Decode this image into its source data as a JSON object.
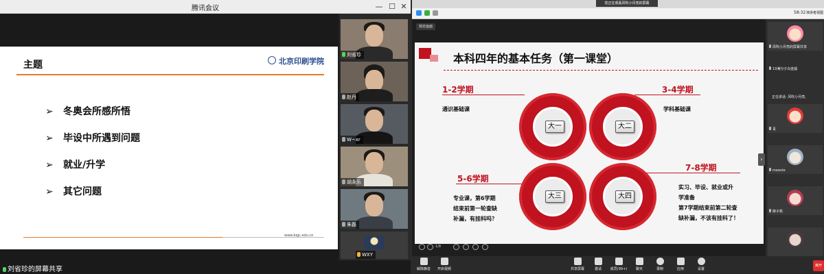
{
  "left_window": {
    "title": "腾讯会议",
    "controls": {
      "minimize": "—",
      "maximize": "☐",
      "close": "✕"
    },
    "slide": {
      "title": "主题",
      "logo_text": "北京印刷学院",
      "bullet_symbol": "➢",
      "bullets": [
        "冬奥会所感所悟",
        "毕设中所遇到问题",
        "就业/升学",
        "其它问题"
      ],
      "url": "www.bigc.edu.cn"
    },
    "participants": [
      {
        "name": "刘省珍"
      },
      {
        "name": "赵丹"
      },
      {
        "name": "W~xr"
      },
      {
        "name": "胡永乐"
      },
      {
        "name": "朱磊"
      },
      {
        "name": "WXY"
      }
    ],
    "share_status": "刘省珍的屏幕共享"
  },
  "right_window": {
    "banner": "您正在观看风吹小月亮的屏幕",
    "clock": "58:32",
    "fullscreen_label": "演讲者视图",
    "lock_label": "锁定画面",
    "slide": {
      "title": "本科四年的基本任务（第一课堂）",
      "quadrants": [
        {
          "gear_label": "大一",
          "semester": "1-2学期",
          "category": "通识基础课",
          "desc": []
        },
        {
          "gear_label": "大二",
          "semester": "3-4学期",
          "category": "学科基础课",
          "desc": []
        },
        {
          "gear_label": "大三",
          "semester": "5-6学期",
          "category": "",
          "desc": [
            "专业课，第6学期",
            "结束前第一轮查缺",
            "补漏，有挂科吗？"
          ]
        },
        {
          "gear_label": "大四",
          "semester": "7-8学期",
          "category": "",
          "desc": [
            "实习、毕设、就业或升",
            "学准备",
            "第7学期结束前第二轮查",
            "缺补漏，不该有挂科了！"
          ]
        }
      ]
    },
    "slide_pages": "1/8",
    "participants": [
      {
        "name": "风吹小月亮的屏幕共享"
      },
      {
        "name": "19满分子白金般"
      },
      {
        "name": "青"
      },
      {
        "name": "meeste"
      },
      {
        "name": "柳子帆"
      }
    ],
    "speaking_label": "正在讲话: 风吹小月亮,",
    "toolbar": [
      {
        "label": "解除静音"
      },
      {
        "label": "开启视频"
      },
      {
        "label": "共享屏幕"
      },
      {
        "label": "邀请"
      },
      {
        "label": "成员(99+)"
      },
      {
        "label": "聊天"
      },
      {
        "label": "录制"
      },
      {
        "label": "应用"
      },
      {
        "label": "设置"
      }
    ],
    "leave_label": "离开"
  },
  "colors": {
    "accent_red": "#c1121f",
    "accent_orange": "#e07b22",
    "mic_green": "#4cd964"
  }
}
